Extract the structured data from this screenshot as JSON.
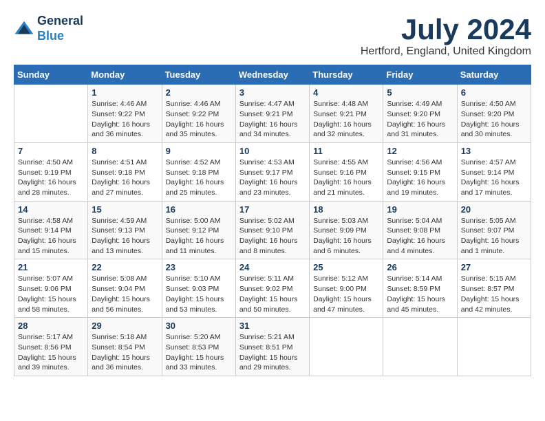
{
  "logo": {
    "general": "General",
    "blue": "Blue"
  },
  "title": {
    "month": "July 2024",
    "location": "Hertford, England, United Kingdom"
  },
  "calendar": {
    "headers": [
      "Sunday",
      "Monday",
      "Tuesday",
      "Wednesday",
      "Thursday",
      "Friday",
      "Saturday"
    ],
    "weeks": [
      [
        {
          "day": "",
          "info": ""
        },
        {
          "day": "1",
          "info": "Sunrise: 4:46 AM\nSunset: 9:22 PM\nDaylight: 16 hours\nand 36 minutes."
        },
        {
          "day": "2",
          "info": "Sunrise: 4:46 AM\nSunset: 9:22 PM\nDaylight: 16 hours\nand 35 minutes."
        },
        {
          "day": "3",
          "info": "Sunrise: 4:47 AM\nSunset: 9:21 PM\nDaylight: 16 hours\nand 34 minutes."
        },
        {
          "day": "4",
          "info": "Sunrise: 4:48 AM\nSunset: 9:21 PM\nDaylight: 16 hours\nand 32 minutes."
        },
        {
          "day": "5",
          "info": "Sunrise: 4:49 AM\nSunset: 9:20 PM\nDaylight: 16 hours\nand 31 minutes."
        },
        {
          "day": "6",
          "info": "Sunrise: 4:50 AM\nSunset: 9:20 PM\nDaylight: 16 hours\nand 30 minutes."
        }
      ],
      [
        {
          "day": "7",
          "info": "Sunrise: 4:50 AM\nSunset: 9:19 PM\nDaylight: 16 hours\nand 28 minutes."
        },
        {
          "day": "8",
          "info": "Sunrise: 4:51 AM\nSunset: 9:18 PM\nDaylight: 16 hours\nand 27 minutes."
        },
        {
          "day": "9",
          "info": "Sunrise: 4:52 AM\nSunset: 9:18 PM\nDaylight: 16 hours\nand 25 minutes."
        },
        {
          "day": "10",
          "info": "Sunrise: 4:53 AM\nSunset: 9:17 PM\nDaylight: 16 hours\nand 23 minutes."
        },
        {
          "day": "11",
          "info": "Sunrise: 4:55 AM\nSunset: 9:16 PM\nDaylight: 16 hours\nand 21 minutes."
        },
        {
          "day": "12",
          "info": "Sunrise: 4:56 AM\nSunset: 9:15 PM\nDaylight: 16 hours\nand 19 minutes."
        },
        {
          "day": "13",
          "info": "Sunrise: 4:57 AM\nSunset: 9:14 PM\nDaylight: 16 hours\nand 17 minutes."
        }
      ],
      [
        {
          "day": "14",
          "info": "Sunrise: 4:58 AM\nSunset: 9:14 PM\nDaylight: 16 hours\nand 15 minutes."
        },
        {
          "day": "15",
          "info": "Sunrise: 4:59 AM\nSunset: 9:13 PM\nDaylight: 16 hours\nand 13 minutes."
        },
        {
          "day": "16",
          "info": "Sunrise: 5:00 AM\nSunset: 9:12 PM\nDaylight: 16 hours\nand 11 minutes."
        },
        {
          "day": "17",
          "info": "Sunrise: 5:02 AM\nSunset: 9:10 PM\nDaylight: 16 hours\nand 8 minutes."
        },
        {
          "day": "18",
          "info": "Sunrise: 5:03 AM\nSunset: 9:09 PM\nDaylight: 16 hours\nand 6 minutes."
        },
        {
          "day": "19",
          "info": "Sunrise: 5:04 AM\nSunset: 9:08 PM\nDaylight: 16 hours\nand 4 minutes."
        },
        {
          "day": "20",
          "info": "Sunrise: 5:05 AM\nSunset: 9:07 PM\nDaylight: 16 hours\nand 1 minute."
        }
      ],
      [
        {
          "day": "21",
          "info": "Sunrise: 5:07 AM\nSunset: 9:06 PM\nDaylight: 15 hours\nand 58 minutes."
        },
        {
          "day": "22",
          "info": "Sunrise: 5:08 AM\nSunset: 9:04 PM\nDaylight: 15 hours\nand 56 minutes."
        },
        {
          "day": "23",
          "info": "Sunrise: 5:10 AM\nSunset: 9:03 PM\nDaylight: 15 hours\nand 53 minutes."
        },
        {
          "day": "24",
          "info": "Sunrise: 5:11 AM\nSunset: 9:02 PM\nDaylight: 15 hours\nand 50 minutes."
        },
        {
          "day": "25",
          "info": "Sunrise: 5:12 AM\nSunset: 9:00 PM\nDaylight: 15 hours\nand 47 minutes."
        },
        {
          "day": "26",
          "info": "Sunrise: 5:14 AM\nSunset: 8:59 PM\nDaylight: 15 hours\nand 45 minutes."
        },
        {
          "day": "27",
          "info": "Sunrise: 5:15 AM\nSunset: 8:57 PM\nDaylight: 15 hours\nand 42 minutes."
        }
      ],
      [
        {
          "day": "28",
          "info": "Sunrise: 5:17 AM\nSunset: 8:56 PM\nDaylight: 15 hours\nand 39 minutes."
        },
        {
          "day": "29",
          "info": "Sunrise: 5:18 AM\nSunset: 8:54 PM\nDaylight: 15 hours\nand 36 minutes."
        },
        {
          "day": "30",
          "info": "Sunrise: 5:20 AM\nSunset: 8:53 PM\nDaylight: 15 hours\nand 33 minutes."
        },
        {
          "day": "31",
          "info": "Sunrise: 5:21 AM\nSunset: 8:51 PM\nDaylight: 15 hours\nand 29 minutes."
        },
        {
          "day": "",
          "info": ""
        },
        {
          "day": "",
          "info": ""
        },
        {
          "day": "",
          "info": ""
        }
      ]
    ]
  }
}
